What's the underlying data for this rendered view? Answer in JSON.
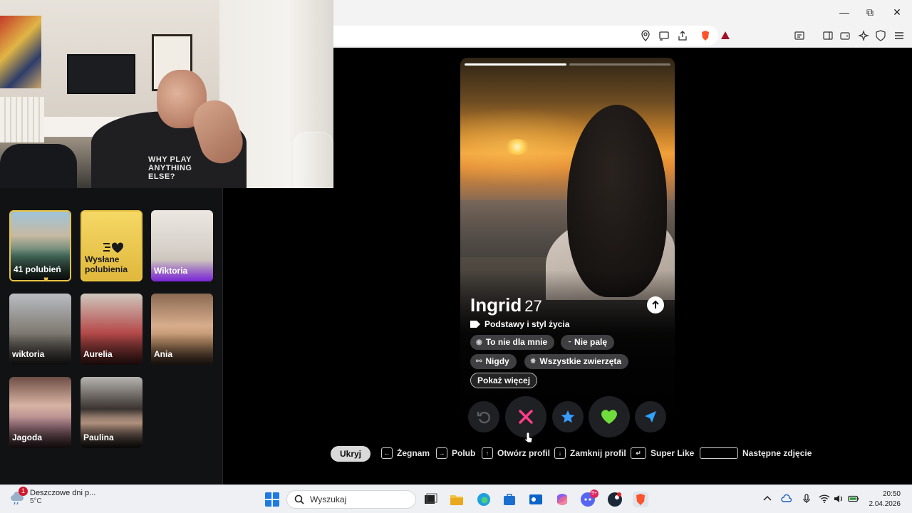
{
  "webcam": {
    "shirt_text": "WHY PLAY ANYTHING ELSE?"
  },
  "matches": [
    {
      "name": "41 polubień",
      "style": "gold",
      "color": "#4d7a6a"
    },
    {
      "name": "Wysłane polubienia",
      "style": "likes-sent",
      "color": "#f0cf55"
    },
    {
      "name": "Wiktoria",
      "style": "purple",
      "color": "#d6d0c9"
    },
    {
      "name": "wiktoria",
      "style": "normal",
      "color": "#7f7a72"
    },
    {
      "name": "Aurelia",
      "style": "normal",
      "color": "#b54a4a"
    },
    {
      "name": "Ania",
      "style": "normal",
      "color": "#b58a64"
    },
    {
      "name": "Jagoda",
      "style": "normal",
      "color": "#a57a86"
    },
    {
      "name": "Paulina",
      "style": "normal",
      "color": "#3a3330"
    }
  ],
  "profile": {
    "name": "Ingrid",
    "age": "27",
    "section_label": "Podstawy i styl życia",
    "chips": [
      "To nie dla mnie",
      "Nie palę",
      "Nigdy",
      "Wszystkie zwierzęta"
    ],
    "show_more": "Pokaż więcej",
    "photo_count": 2,
    "active_photo": 0
  },
  "shortcuts": {
    "hide": "Ukryj",
    "nope": "Żegnam",
    "like": "Polub",
    "open_profile": "Otwórz profil",
    "close_profile": "Zamknij profil",
    "super_like": "Super Like",
    "next_photo": "Następne zdjęcie"
  },
  "taskbar": {
    "weather_title": "Deszczowe dni p...",
    "weather_temp": "5°C",
    "weather_badge": "1",
    "search_placeholder": "Wyszukaj",
    "time": "20:50",
    "date": "2.04.2026"
  },
  "colors": {
    "nope": "#ff3d8b",
    "super_like": "#3a9bff",
    "like": "#6fdc3c",
    "boost": "#2fa3ff",
    "gold": "#e8c341"
  }
}
